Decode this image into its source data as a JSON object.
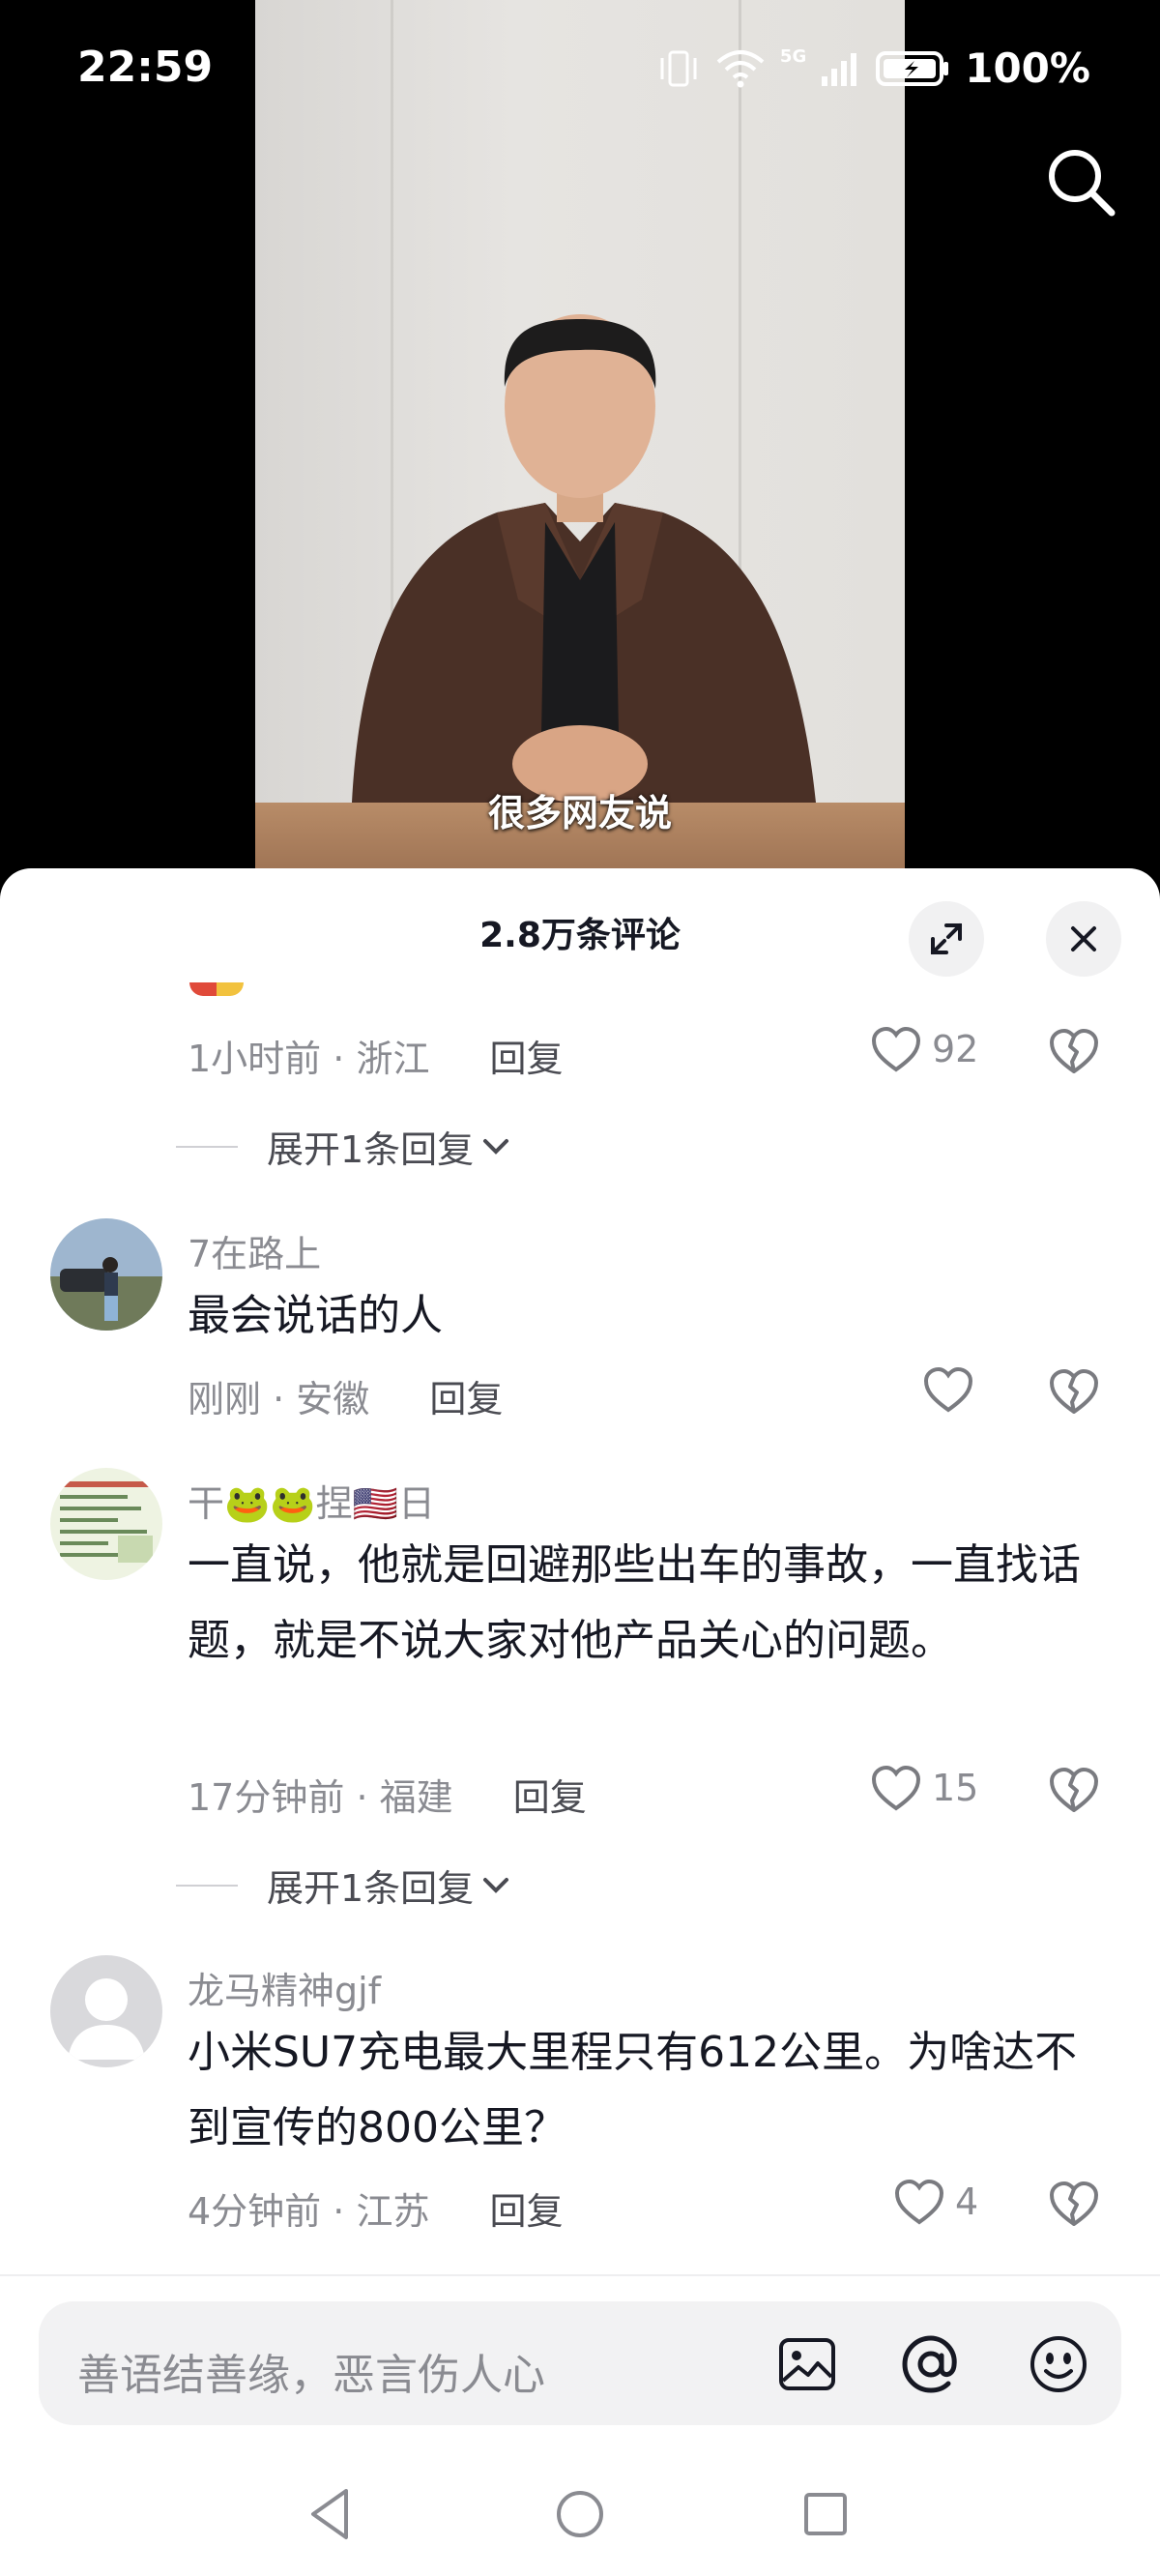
{
  "status_bar": {
    "time": "22:59",
    "battery": "100%",
    "network": "5G"
  },
  "video": {
    "subtitle": "很多网友说"
  },
  "comments_panel": {
    "title": "2.8万条评论",
    "comments": [
      {
        "time": "1小时前",
        "location": "浙江",
        "reply_label": "回复",
        "likes": "92",
        "expand_label": "展开1条回复"
      },
      {
        "username": "7在路上",
        "text": "最会说话的人",
        "time": "刚刚",
        "location": "安徽",
        "reply_label": "回复",
        "likes": ""
      },
      {
        "username": "干🐸🐸捏🇺🇸日",
        "text": "一直说，他就是回避那些出车的事故，一直找话题，就是不说大家对他产品关心的问题。",
        "time": "17分钟前",
        "location": "福建",
        "reply_label": "回复",
        "likes": "15",
        "expand_label": "展开1条回复"
      },
      {
        "username": "龙马精神gjf",
        "text": "小米SU7充电最大里程只有612公里。为啥达不到宣传的800公里？",
        "time": "4分钟前",
        "location": "江苏",
        "reply_label": "回复",
        "likes": "4"
      }
    ]
  },
  "input": {
    "placeholder": "善语结善缘，恶言伤人心"
  },
  "icons": {
    "search": "search-icon",
    "expand": "expand-icon",
    "close": "close-icon",
    "like": "heart-icon",
    "dislike": "broken-heart-icon",
    "image": "image-icon",
    "mention": "at-icon",
    "emoji": "emoji-icon",
    "back": "nav-back-icon",
    "home": "nav-home-icon",
    "recents": "nav-recents-icon"
  },
  "colors": {
    "text_primary": "#161823",
    "text_secondary": "#8a8b91",
    "sheet_bg": "#ffffff",
    "input_bg": "#f2f2f3"
  }
}
